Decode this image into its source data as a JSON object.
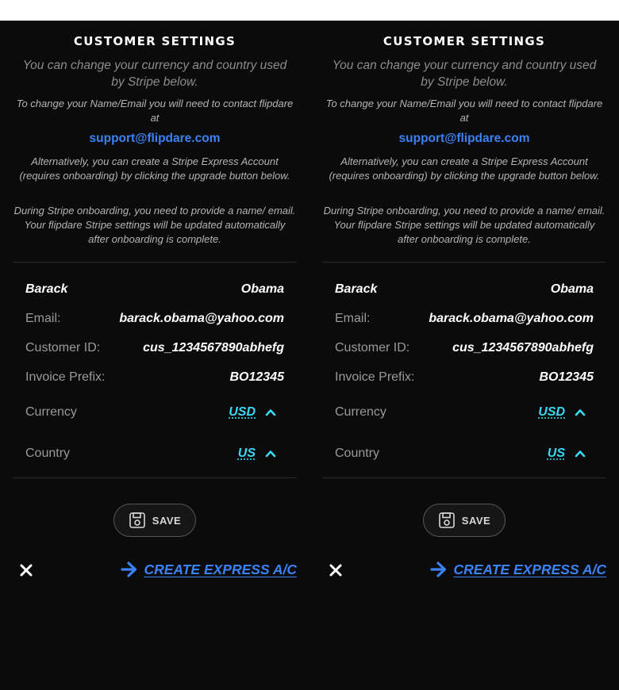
{
  "panels": [
    {
      "title": "CUSTOMER SETTINGS",
      "subtitle": "You can change your currency and country used by Stripe below.",
      "contact_note": "To change your Name/Email you will need to contact flipdare at",
      "support_email": "support@flipdare.com",
      "express_note": "Alternatively, you can create a Stripe Express Account (requires onboarding) by clicking the upgrade button below.",
      "onboarding_note": "During Stripe onboarding, you need to provide a name/ email. Your flipdare Stripe settings will be updated automatically after onboarding is complete.",
      "first_name": "Barack",
      "last_name": "Obama",
      "email_label": "Email:",
      "email_value": "barack.obama@yahoo.com",
      "customer_id_label": "Customer ID:",
      "customer_id_value": "cus_1234567890abhefg",
      "invoice_prefix_label": "Invoice Prefix:",
      "invoice_prefix_value": "BO12345",
      "currency_label": "Currency",
      "currency_value": "USD",
      "country_label": "Country",
      "country_value": "US",
      "save_label": "SAVE",
      "create_express_label": "CREATE EXPRESS A/C"
    },
    {
      "title": "CUSTOMER SETTINGS",
      "subtitle": "You can change your currency and country used by Stripe below.",
      "contact_note": "To change your Name/Email you will need to contact flipdare at",
      "support_email": "support@flipdare.com",
      "express_note": "Alternatively, you can create a Stripe Express Account (requires onboarding) by clicking the upgrade button below.",
      "onboarding_note": "During Stripe onboarding, you need to provide a name/ email. Your flipdare Stripe settings will be updated automatically after onboarding is complete.",
      "first_name": "Barack",
      "last_name": "Obama",
      "email_label": "Email:",
      "email_value": "barack.obama@yahoo.com",
      "customer_id_label": "Customer ID:",
      "customer_id_value": "cus_1234567890abhefg",
      "invoice_prefix_label": "Invoice Prefix:",
      "invoice_prefix_value": "BO12345",
      "currency_label": "Currency",
      "currency_value": "USD",
      "country_label": "Country",
      "country_value": "US",
      "save_label": "SAVE",
      "create_express_label": "CREATE EXPRESS A/C"
    }
  ],
  "colors": {
    "background": "#0b0b0b",
    "link": "#3b82f6",
    "select_value": "#38d9f5",
    "muted_text": "#8c8c8c"
  },
  "icons": {
    "save": "floppy-disk-icon",
    "close": "close-icon",
    "arrow": "arrow-right-icon",
    "chevron": "chevron-up-icon"
  }
}
